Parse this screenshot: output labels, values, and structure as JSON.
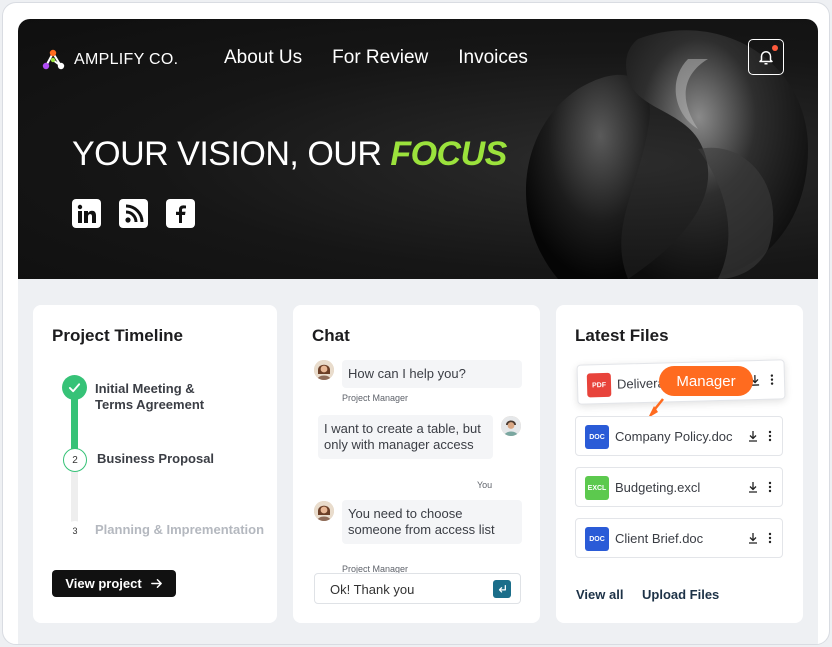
{
  "brand": {
    "name": "AMPLIFY CO."
  },
  "nav": [
    {
      "label": "About Us"
    },
    {
      "label": "For Review"
    },
    {
      "label": "Invoices"
    }
  ],
  "hero": {
    "headline_main": "YOUR VISION, OUR ",
    "headline_accent": "FOCUS",
    "accent_color": "#9be23c",
    "socials": [
      "linkedin-icon",
      "rss-icon",
      "facebook-icon"
    ]
  },
  "timeline": {
    "title": "Project Timeline",
    "steps": [
      {
        "label": "Initial Meeting & Terms Agreement",
        "status": "done",
        "marker": ""
      },
      {
        "label": "Business Proposal",
        "status": "current",
        "marker": "2"
      },
      {
        "label": "Planning & Imprementation",
        "status": "upcoming",
        "marker": "3"
      }
    ],
    "button_label": "View project"
  },
  "chat": {
    "title": "Chat",
    "messages": [
      {
        "text": "How can I help you?",
        "sender": "Project Manager"
      },
      {
        "text": "I want to create a table, but only with manager access",
        "sender": "You"
      },
      {
        "text": "You need to choose someone from access list",
        "sender": "Project Manager"
      }
    ],
    "input_value": "Ok! Thank you"
  },
  "files": {
    "title": "Latest Files",
    "tooltip": "Manager",
    "items": [
      {
        "name": "Delivera",
        "badge": "PDF",
        "color": "#e8433b"
      },
      {
        "name": "Company Policy.doc",
        "badge": "DOC",
        "color": "#2a5bd7"
      },
      {
        "name": "Budgeting.excl",
        "badge": "EXCL",
        "color": "#5cc94e"
      },
      {
        "name": "Client Brief.doc",
        "badge": "DOC",
        "color": "#2a5bd7"
      }
    ],
    "view_all": "View all",
    "upload": "Upload Files"
  }
}
